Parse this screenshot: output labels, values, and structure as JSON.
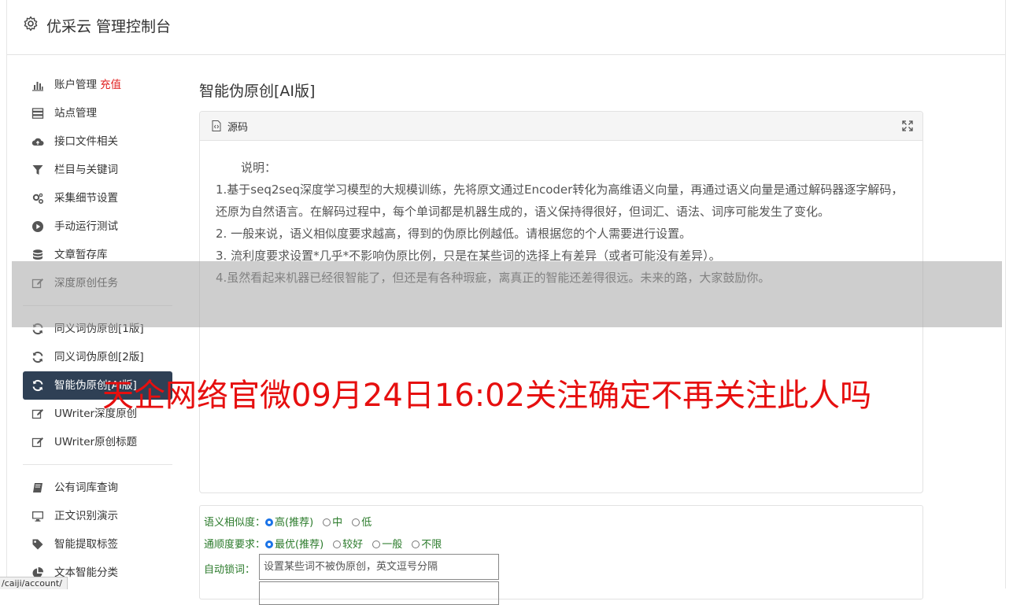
{
  "header": {
    "title": "优采云 管理控制台"
  },
  "sidebar": {
    "group1": [
      {
        "label": "账户管理",
        "badge": "充值",
        "icon": "bar-chart-icon"
      },
      {
        "label": "站点管理",
        "icon": "server-icon"
      },
      {
        "label": "接口文件相关",
        "icon": "cloud-upload-icon"
      },
      {
        "label": "栏目与关键词",
        "icon": "filter-icon"
      },
      {
        "label": "采集细节设置",
        "icon": "gears-icon"
      },
      {
        "label": "手动运行测试",
        "icon": "play-circle-icon"
      },
      {
        "label": "文章暂存库",
        "icon": "database-icon"
      },
      {
        "label": "深度原创任务",
        "icon": "edit-icon"
      }
    ],
    "group2": [
      {
        "label": "同义词伪原创[1版]",
        "icon": "refresh-icon"
      },
      {
        "label": "同义词伪原创[2版]",
        "icon": "refresh-icon"
      },
      {
        "label": "智能伪原创[AI版]",
        "icon": "refresh-icon",
        "active": true
      },
      {
        "label": "UWriter深度原创",
        "icon": "edit-icon"
      },
      {
        "label": "UWriter原创标题",
        "icon": "edit-icon"
      }
    ],
    "group3": [
      {
        "label": "公有词库查询",
        "icon": "book-icon"
      },
      {
        "label": "正文识别演示",
        "icon": "monitor-icon"
      },
      {
        "label": "智能提取标签",
        "icon": "tag-icon"
      },
      {
        "label": "文本智能分类",
        "icon": "pie-chart-icon"
      }
    ]
  },
  "main": {
    "title": "智能伪原创[AI版]",
    "panel": {
      "header": "源码",
      "lead": "说明：",
      "lines": [
        "1.基于seq2seq深度学习模型的大规模训练，先将原文通过Encoder转化为高维语义向量，再通过语义向量是通过解码器逐字解码，还原为自然语言。在解码过程中，每个单词都是机器生成的，语义保持得很好，但词汇、语法、词序可能发生了变化。",
        "2. 一般来说，语义相似度要求越高，得到的伪原比例越低。请根据您的个人需要进行设置。",
        "3. 流利度要求设置*几乎*不影响伪原比例，只是在某些词的选择上有差异（或者可能没有差异）。",
        "4.虽然看起来机器已经很智能了，但还是有各种瑕疵，离真正的智能还差得很远。未来的路，大家鼓励你。"
      ]
    },
    "form": {
      "similarity": {
        "label": "语义相似度：",
        "options": [
          "高(推荐)",
          "中",
          "低"
        ],
        "selected": 0
      },
      "fluency": {
        "label": "通顺度要求：",
        "options": [
          "最优(推荐)",
          "较好",
          "一般",
          "不限"
        ],
        "selected": 0
      },
      "lock": {
        "label": "自动锁词：",
        "placeholder": "设置某些词不被伪原创，英文逗号分隔",
        "value": ""
      }
    }
  },
  "overlay": {
    "text": "天企网络官微09月24日16:02关注确定不再关注此人吗"
  },
  "status_bar": {
    "url": "/caiji/account/"
  },
  "colors": {
    "active_nav_bg": "#2f4055",
    "badge": "#e02020",
    "overlay_text": "#e60f0f",
    "form_label": "#2a7a2a"
  }
}
